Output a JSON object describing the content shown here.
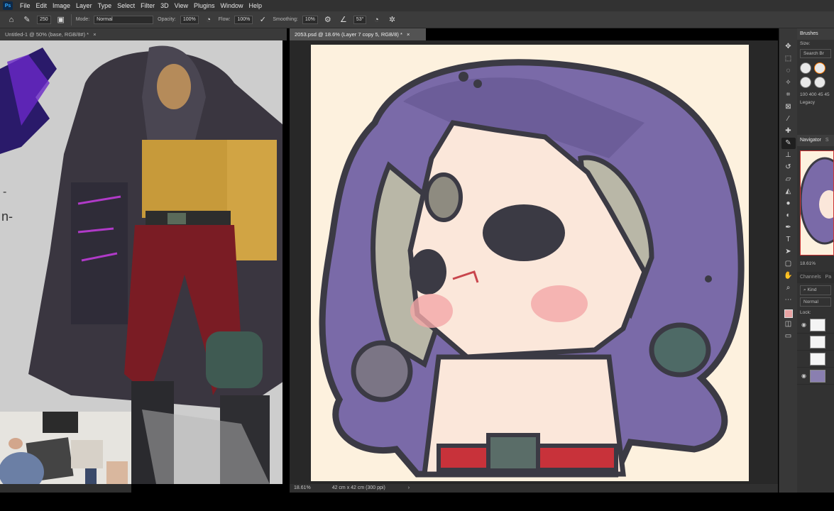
{
  "app": {
    "logo": "Ps"
  },
  "menu": [
    "File",
    "Edit",
    "Image",
    "Layer",
    "Type",
    "Select",
    "Filter",
    "3D",
    "View",
    "Plugins",
    "Window",
    "Help"
  ],
  "options": {
    "brush_size": "250",
    "mode_label": "Mode:",
    "mode_value": "Normal",
    "opacity_label": "Opacity:",
    "opacity_value": "100%",
    "flow_label": "Flow:",
    "flow_value": "100%",
    "smoothing_label": "Smoothing:",
    "smoothing_value": "10%",
    "angle_value": "53°"
  },
  "tabs": [
    {
      "label": "Untitled-1 @ 50% (base, RGB/8#) *",
      "close": "×"
    },
    {
      "label": "2053.psd @ 18.6% (Layer 7 copy 5, RGB/8) *",
      "close": "×"
    }
  ],
  "status": {
    "zoom": "18.61%",
    "doc_size": "42 cm x 42 cm (300 ppi)",
    "arrow": "›"
  },
  "left_doc_fragments": [
    "-",
    "n-"
  ],
  "panels": {
    "brushes_tab": "Brushes",
    "size_label": "Size:",
    "search_placeholder": "Search Br",
    "brush_sizes": [
      "100",
      "400",
      "45",
      "45"
    ],
    "legacy_label": "Legacy",
    "navigator_tab": "Navigator",
    "navigator_tab2": "S",
    "zoom": "18.61%",
    "channels_tab": "Channels",
    "paths_tab": "Pa",
    "kind_label": "Kind",
    "blend_mode": "Normal",
    "lock_label": "Lock:"
  },
  "tools": [
    "move-icon",
    "marquee-icon",
    "lasso-icon",
    "magic-wand-icon",
    "crop-icon",
    "frame-icon",
    "eyedropper-icon",
    "healing-icon",
    "brush-icon",
    "stamp-icon",
    "history-brush-icon",
    "eraser-icon",
    "bucket-icon",
    "blur-icon",
    "dodge-icon",
    "pen-icon",
    "type-icon",
    "path-select-icon",
    "shape-icon",
    "hand-icon",
    "zoom-icon",
    "more-icon"
  ],
  "colors": {
    "accent_selection": "#ff7a00",
    "foreground": "#e8a3a3",
    "canvas_bg": "#fdf1de",
    "hood_purple": "#7a6aa8"
  }
}
